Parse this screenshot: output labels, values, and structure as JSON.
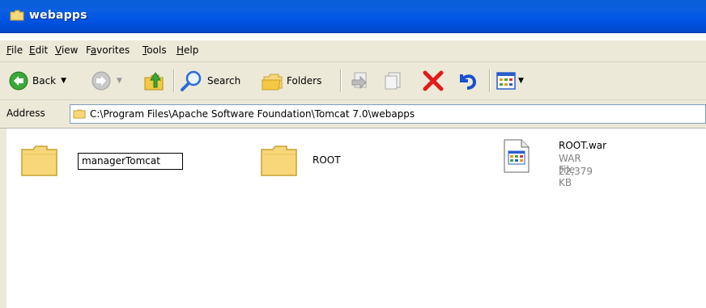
{
  "window": {
    "title": "webapps"
  },
  "menu": {
    "file": "File",
    "file_key": "F",
    "edit": "Edit",
    "edit_key": "E",
    "view": "View",
    "view_key": "V",
    "favorites": "Favorites",
    "favorites_key": "a",
    "tools": "Tools",
    "tools_key": "T",
    "help": "Help",
    "help_key": "H"
  },
  "toolbar": {
    "back_label": "Back",
    "search_label": "Search",
    "folders_label": "Folders"
  },
  "address": {
    "label": "Address",
    "path": "C:\\Program Files\\Apache Software Foundation\\Tomcat 7.0\\webapps"
  },
  "items": [
    {
      "name": "managerTomcat",
      "kind": "folder",
      "renaming": true
    },
    {
      "name": "ROOT",
      "kind": "folder"
    },
    {
      "name": "ROOT.war",
      "type": "WAR File",
      "size": "22,379 KB",
      "kind": "file"
    }
  ]
}
